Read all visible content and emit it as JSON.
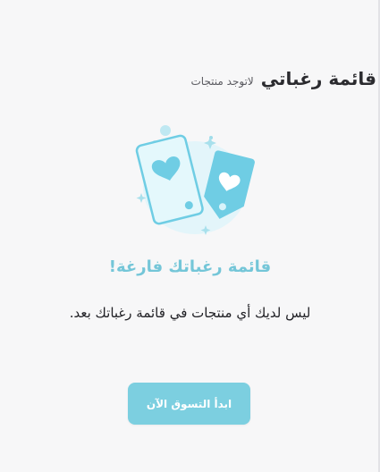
{
  "header": {
    "title": "قائمة رغباتي",
    "count_text": "لاتوجد منتجات"
  },
  "empty_state": {
    "title": "قائمة رغباتك فارغة!",
    "description": "ليس لديك أي منتجات في قائمة رغباتك بعد.",
    "button_label": "ابدأ التسوق الآن",
    "illustration_icon": "heart-tags-icon"
  },
  "colors": {
    "background": "#f7f7f8",
    "accent": "#7ccfe0",
    "accent_dark": "#74c6d8",
    "text": "#1f1f24"
  }
}
